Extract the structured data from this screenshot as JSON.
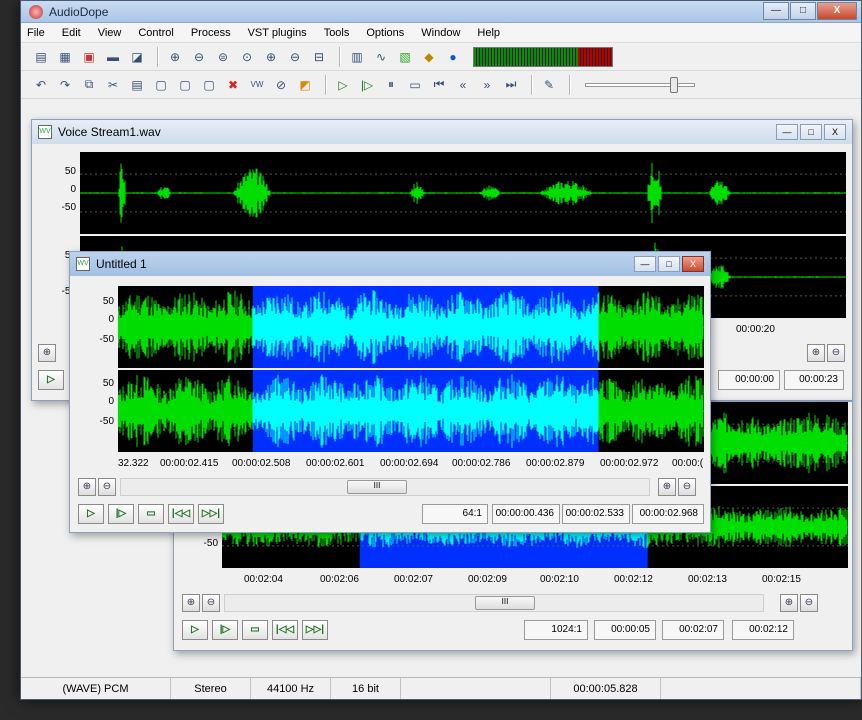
{
  "app": {
    "title": "AudioDope"
  },
  "caption_buttons": {
    "minimize": "—",
    "maximize": "□",
    "close": "X"
  },
  "menu": [
    "File",
    "Edit",
    "View",
    "Control",
    "Process",
    "VST plugins",
    "Tools",
    "Options",
    "Window",
    "Help"
  ],
  "toolbar1": [
    "new-doc",
    "open",
    "close-doc",
    "save",
    "save-as",
    "zoom-in",
    "zoom-out",
    "zoom-full",
    "zoom-select",
    "zoom-in-v",
    "zoom-out-v",
    "zoom-fit",
    "spectrum",
    "waveform",
    "dx-fx",
    "vst",
    "info"
  ],
  "toolbar2": [
    "undo",
    "redo",
    "copy",
    "cut",
    "paste",
    "paste-mix",
    "paste-new",
    "crop",
    "delete",
    "silence",
    "invert",
    "reverse"
  ],
  "transport": [
    "play",
    "play-sel",
    "pause",
    "stop",
    "to-start",
    "rewind",
    "forward",
    "to-end",
    "record"
  ],
  "window1": {
    "title": "Voice Stream1.wav",
    "scale": [
      "50",
      "0",
      "-50"
    ],
    "time_label": "00:00:20",
    "fields": [
      "00:00:00",
      "00:00:23"
    ]
  },
  "window3": {
    "scale": [
      "-50"
    ],
    "timeline": [
      "00:02:04",
      "00:02:06",
      "00:02:07",
      "00:02:09",
      "00:02:10",
      "00:02:12",
      "00:02:13",
      "00:02:15"
    ],
    "scroll_thumb": "III",
    "fields": [
      "1024:1",
      "00:00:05",
      "00:02:07",
      "00:02:12"
    ]
  },
  "window2": {
    "title": "Untitled 1",
    "scale": [
      "50",
      "0",
      "-50"
    ],
    "timeline": [
      "32.322",
      "00:00:02.415",
      "00:00:02.508",
      "00:00:02.601",
      "00:00:02.694",
      "00:00:02.786",
      "00:00:02.879",
      "00:00:02.972",
      "00:00:("
    ],
    "scroll_thumb": "III",
    "fields": [
      "64:1",
      "00:00:00.436",
      "00:00:02.533",
      "00:00:02.968"
    ]
  },
  "playback_icons": [
    "▷",
    "|▷",
    "▭",
    "|◁◁",
    "▷▷|"
  ],
  "zoom_icons": [
    "⊕",
    "⊖"
  ],
  "status": {
    "format": "(WAVE) PCM",
    "channels": "Stereo",
    "rate": "44100 Hz",
    "bits": "16 bit",
    "length": "00:00:05.828"
  },
  "colors": {
    "wave": "#00dd00",
    "selection_bg": "#0030ff",
    "selection_wave": "#00ffff",
    "background": "#000000"
  }
}
